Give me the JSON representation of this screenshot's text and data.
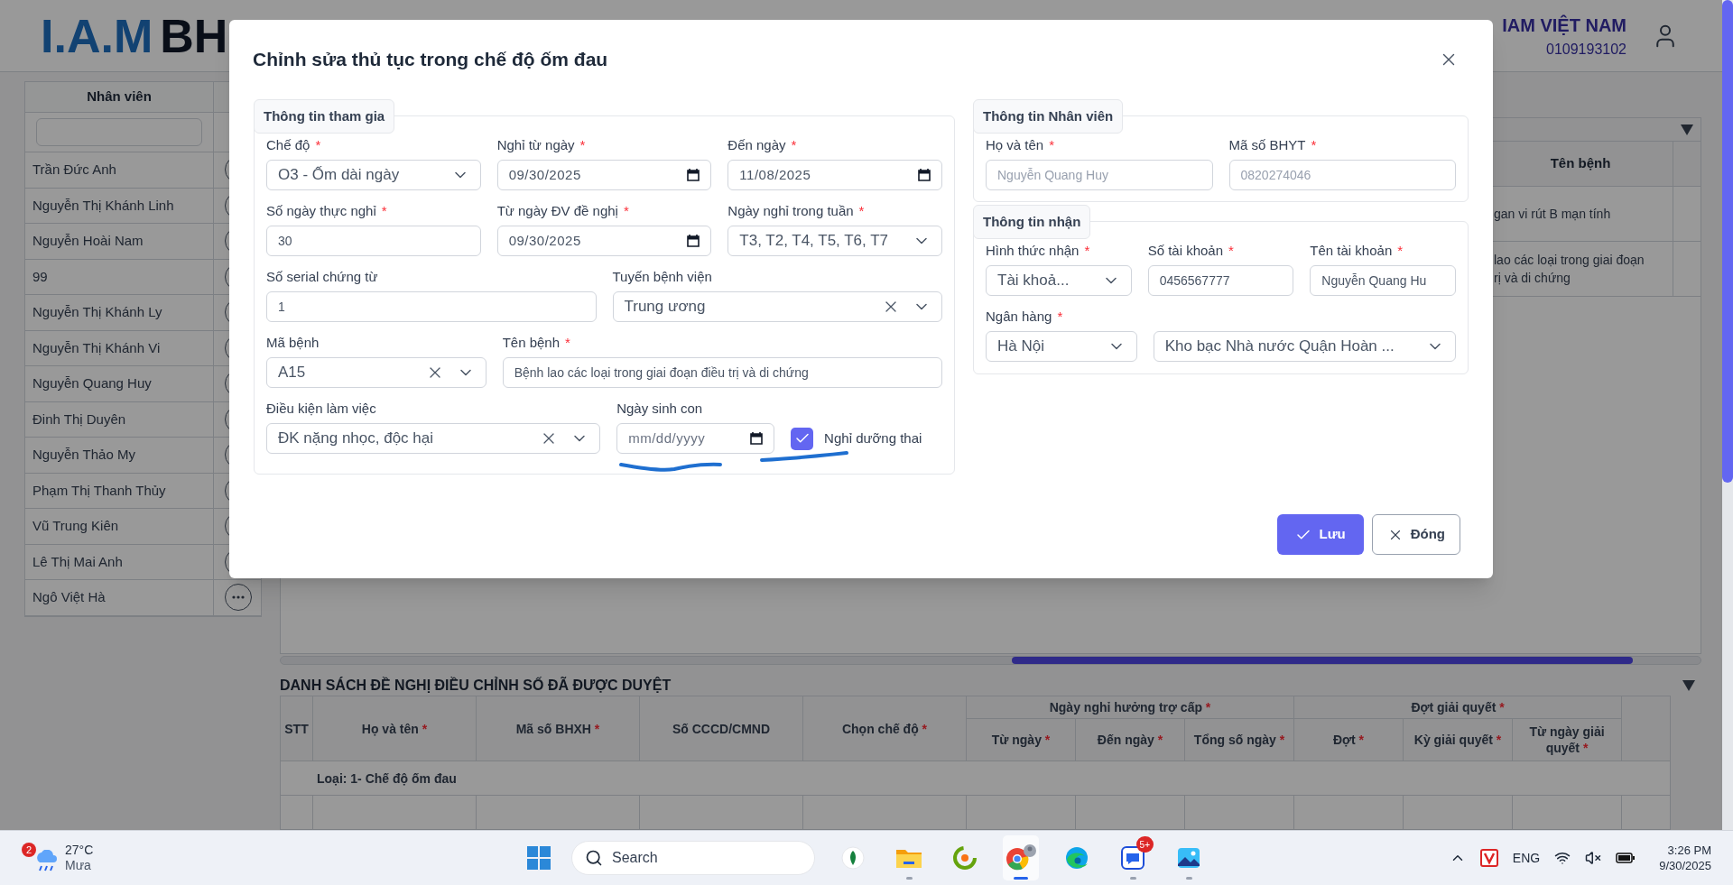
{
  "header": {
    "logo_mark": "I.A.M",
    "logo_text": "BH",
    "company": "IAM VIỆT NAM",
    "tax_code": "0109193102"
  },
  "employees": {
    "column": "Nhân viên",
    "rows": [
      "Trần Đức Anh",
      "Nguyễn Thị Khánh Linh",
      "Nguyễn Hoài Nam",
      "99",
      "Nguyễn Thị Khánh Ly",
      "Nguyễn Thị Khánh Vi",
      "Nguyễn Quang Huy",
      "Đinh Thị Duyên",
      "Nguyễn Thảo My",
      "Phạm Thị Thanh Thủy",
      "Vũ Trung Kiên",
      "Lê Thị Mai Anh",
      "Ngô Việt Hà"
    ]
  },
  "top_table": {
    "column": "Tên bệnh",
    "rows": [
      {
        "lines": [
          "gan vi rút B mạn tính"
        ]
      },
      {
        "lines": [
          "lao các loại trong giai đoạn",
          "rị và di chứng"
        ]
      }
    ]
  },
  "approved_section": {
    "title": "DANH SÁCH ĐỀ NGHỊ ĐIỀU CHỈNH SỐ ĐÃ ĐƯỢC DUYỆT",
    "columns": [
      {
        "label": "STT"
      },
      {
        "label": "Họ và tên",
        "required_mark": "*"
      },
      {
        "label": "Mã số BHXH",
        "required_mark": "*"
      },
      {
        "label": "Số CCCD/CMND"
      },
      {
        "label": "Chọn chế độ",
        "required_mark": "*"
      },
      {
        "label": "Ngày nghỉ hưởng trợ cấp",
        "required_mark": "*",
        "children": [
          {
            "label": "Từ ngày",
            "required_mark": "*"
          },
          {
            "label": "Đến ngày",
            "required_mark": "*"
          },
          {
            "label": "Tổng số ngày",
            "required_mark": "*"
          }
        ]
      },
      {
        "label": "Đợt giải quyết",
        "required_mark": "*",
        "children": [
          {
            "label": "Đợt",
            "required_mark": "*"
          },
          {
            "label": "Kỳ giải quyết",
            "required_mark": "*"
          },
          {
            "label": "Từ ngày giải quyết",
            "required_mark": "*"
          }
        ]
      }
    ],
    "group_row": "Loại: 1- Chế độ ốm đau"
  },
  "dialog": {
    "title": "Chỉnh sửa thủ tục trong chế độ ốm đau",
    "groups": [
      {
        "legend": "Thông tin tham gia",
        "rows": [
          [
            {
              "kind": "select",
              "label": "Chế độ",
              "required_mark": "*",
              "value": "O3 - Ốm dài ngày",
              "clearable": false
            },
            {
              "kind": "date",
              "label": "Nghỉ từ ngày",
              "required_mark": "*",
              "value": "09/30/2025"
            },
            {
              "kind": "date",
              "label": "Đến ngày",
              "required_mark": "*",
              "value": "11/08/2025"
            }
          ],
          [
            {
              "kind": "text",
              "label": "Số ngày thực nghỉ",
              "required_mark": "*",
              "value": "30",
              "disabled": false
            },
            {
              "kind": "date",
              "label": "Từ ngày ĐV đề nghị",
              "required_mark": "*",
              "value": "09/30/2025"
            },
            {
              "kind": "select",
              "label": "Ngày nghỉ trong tuần",
              "required_mark": "*",
              "value": "T3, T2, T4, T5, T6, T7",
              "clearable": false
            }
          ],
          [
            {
              "kind": "text",
              "label": "Số serial chứng từ",
              "value": "1",
              "disabled": false
            },
            {
              "kind": "select",
              "label": "Tuyến bệnh viện",
              "value": "Trung ương",
              "clearable": true
            }
          ],
          [
            {
              "kind": "select",
              "label": "Mã bệnh",
              "value": "A15",
              "clearable": true
            },
            {
              "kind": "text",
              "label": "Tên bệnh",
              "required_mark": "*",
              "value": "Bệnh lao các loại trong giai đoạn điều trị và di chứng",
              "disabled": false
            }
          ],
          [
            {
              "kind": "select",
              "label": "Điều kiện làm việc",
              "value": "ĐK nặng nhọc, độc hại",
              "clearable": true
            },
            {
              "kind": "date",
              "label": "Ngày sinh con",
              "placeholder": "mm/dd/yyyy"
            },
            {
              "kind": "checkbox",
              "label": "Nghỉ dưỡng thai",
              "checked": true
            }
          ]
        ]
      },
      {
        "legend": "Thông tin Nhân viên",
        "rows": [
          [
            {
              "kind": "text",
              "label": "Họ và tên",
              "required_mark": "*",
              "value": "Nguyễn Quang Huy",
              "disabled": true
            },
            {
              "kind": "text",
              "label": "Mã số BHYT",
              "required_mark": "*",
              "value": "0820274046",
              "disabled": true
            }
          ]
        ]
      },
      {
        "legend": "Thông tin nhận",
        "rows": [
          [
            {
              "kind": "select",
              "label": "Hình thức nhận",
              "required_mark": "*",
              "value": "Tài khoả...",
              "clearable": false
            },
            {
              "kind": "text",
              "label": "Số tài khoản",
              "required_mark": "*",
              "value": "0456567777",
              "disabled": false
            },
            {
              "kind": "text",
              "label": "Tên tài khoản",
              "required_mark": "*",
              "value": "Nguyễn Quang Hu",
              "disabled": false
            }
          ],
          [
            {
              "kind": "select",
              "label": "Ngân hàng",
              "required_mark": "*",
              "value": "Hà Nội",
              "clearable": false
            },
            {
              "kind": "select",
              "value": "Kho bạc Nhà nước Quận Hoàn ...",
              "clearable": false
            }
          ]
        ]
      }
    ],
    "buttons": [
      {
        "kind": "primary",
        "label": "Lưu"
      },
      {
        "kind": "secondary",
        "label": "Đóng"
      }
    ]
  },
  "taskbar": {
    "weather": {
      "badge": "2",
      "temp": "27°C",
      "condition": "Mưa"
    },
    "search": "Search",
    "apps": [
      {
        "kind": "leaf",
        "running": false,
        "active": false
      },
      {
        "kind": "folder",
        "running": true,
        "active": false
      },
      {
        "kind": "swirl",
        "running": false,
        "active": false
      },
      {
        "kind": "browser",
        "running": true,
        "active": true
      },
      {
        "kind": "edge",
        "running": false,
        "active": false
      },
      {
        "kind": "chat",
        "badge": "5+",
        "running": true,
        "active": false
      },
      {
        "kind": "photos",
        "running": true,
        "active": false
      }
    ],
    "language": "ENG",
    "time": "3:26 PM",
    "date": "9/30/2025"
  }
}
